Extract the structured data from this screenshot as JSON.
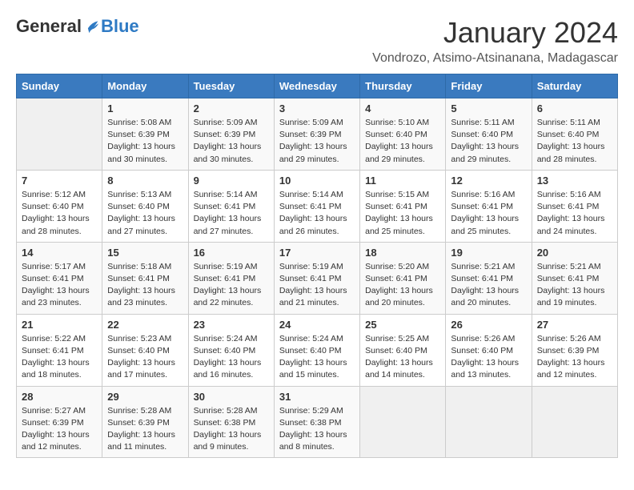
{
  "header": {
    "logo_general": "General",
    "logo_blue": "Blue",
    "month": "January 2024",
    "location": "Vondrozo, Atsimo-Atsinanana, Madagascar"
  },
  "days_of_week": [
    "Sunday",
    "Monday",
    "Tuesday",
    "Wednesday",
    "Thursday",
    "Friday",
    "Saturday"
  ],
  "weeks": [
    [
      {
        "day": "",
        "info": ""
      },
      {
        "day": "1",
        "info": "Sunrise: 5:08 AM\nSunset: 6:39 PM\nDaylight: 13 hours\nand 30 minutes."
      },
      {
        "day": "2",
        "info": "Sunrise: 5:09 AM\nSunset: 6:39 PM\nDaylight: 13 hours\nand 30 minutes."
      },
      {
        "day": "3",
        "info": "Sunrise: 5:09 AM\nSunset: 6:39 PM\nDaylight: 13 hours\nand 29 minutes."
      },
      {
        "day": "4",
        "info": "Sunrise: 5:10 AM\nSunset: 6:40 PM\nDaylight: 13 hours\nand 29 minutes."
      },
      {
        "day": "5",
        "info": "Sunrise: 5:11 AM\nSunset: 6:40 PM\nDaylight: 13 hours\nand 29 minutes."
      },
      {
        "day": "6",
        "info": "Sunrise: 5:11 AM\nSunset: 6:40 PM\nDaylight: 13 hours\nand 28 minutes."
      }
    ],
    [
      {
        "day": "7",
        "info": "Sunrise: 5:12 AM\nSunset: 6:40 PM\nDaylight: 13 hours\nand 28 minutes."
      },
      {
        "day": "8",
        "info": "Sunrise: 5:13 AM\nSunset: 6:40 PM\nDaylight: 13 hours\nand 27 minutes."
      },
      {
        "day": "9",
        "info": "Sunrise: 5:14 AM\nSunset: 6:41 PM\nDaylight: 13 hours\nand 27 minutes."
      },
      {
        "day": "10",
        "info": "Sunrise: 5:14 AM\nSunset: 6:41 PM\nDaylight: 13 hours\nand 26 minutes."
      },
      {
        "day": "11",
        "info": "Sunrise: 5:15 AM\nSunset: 6:41 PM\nDaylight: 13 hours\nand 25 minutes."
      },
      {
        "day": "12",
        "info": "Sunrise: 5:16 AM\nSunset: 6:41 PM\nDaylight: 13 hours\nand 25 minutes."
      },
      {
        "day": "13",
        "info": "Sunrise: 5:16 AM\nSunset: 6:41 PM\nDaylight: 13 hours\nand 24 minutes."
      }
    ],
    [
      {
        "day": "14",
        "info": "Sunrise: 5:17 AM\nSunset: 6:41 PM\nDaylight: 13 hours\nand 23 minutes."
      },
      {
        "day": "15",
        "info": "Sunrise: 5:18 AM\nSunset: 6:41 PM\nDaylight: 13 hours\nand 23 minutes."
      },
      {
        "day": "16",
        "info": "Sunrise: 5:19 AM\nSunset: 6:41 PM\nDaylight: 13 hours\nand 22 minutes."
      },
      {
        "day": "17",
        "info": "Sunrise: 5:19 AM\nSunset: 6:41 PM\nDaylight: 13 hours\nand 21 minutes."
      },
      {
        "day": "18",
        "info": "Sunrise: 5:20 AM\nSunset: 6:41 PM\nDaylight: 13 hours\nand 20 minutes."
      },
      {
        "day": "19",
        "info": "Sunrise: 5:21 AM\nSunset: 6:41 PM\nDaylight: 13 hours\nand 20 minutes."
      },
      {
        "day": "20",
        "info": "Sunrise: 5:21 AM\nSunset: 6:41 PM\nDaylight: 13 hours\nand 19 minutes."
      }
    ],
    [
      {
        "day": "21",
        "info": "Sunrise: 5:22 AM\nSunset: 6:41 PM\nDaylight: 13 hours\nand 18 minutes."
      },
      {
        "day": "22",
        "info": "Sunrise: 5:23 AM\nSunset: 6:40 PM\nDaylight: 13 hours\nand 17 minutes."
      },
      {
        "day": "23",
        "info": "Sunrise: 5:24 AM\nSunset: 6:40 PM\nDaylight: 13 hours\nand 16 minutes."
      },
      {
        "day": "24",
        "info": "Sunrise: 5:24 AM\nSunset: 6:40 PM\nDaylight: 13 hours\nand 15 minutes."
      },
      {
        "day": "25",
        "info": "Sunrise: 5:25 AM\nSunset: 6:40 PM\nDaylight: 13 hours\nand 14 minutes."
      },
      {
        "day": "26",
        "info": "Sunrise: 5:26 AM\nSunset: 6:40 PM\nDaylight: 13 hours\nand 13 minutes."
      },
      {
        "day": "27",
        "info": "Sunrise: 5:26 AM\nSunset: 6:39 PM\nDaylight: 13 hours\nand 12 minutes."
      }
    ],
    [
      {
        "day": "28",
        "info": "Sunrise: 5:27 AM\nSunset: 6:39 PM\nDaylight: 13 hours\nand 12 minutes."
      },
      {
        "day": "29",
        "info": "Sunrise: 5:28 AM\nSunset: 6:39 PM\nDaylight: 13 hours\nand 11 minutes."
      },
      {
        "day": "30",
        "info": "Sunrise: 5:28 AM\nSunset: 6:38 PM\nDaylight: 13 hours\nand 9 minutes."
      },
      {
        "day": "31",
        "info": "Sunrise: 5:29 AM\nSunset: 6:38 PM\nDaylight: 13 hours\nand 8 minutes."
      },
      {
        "day": "",
        "info": ""
      },
      {
        "day": "",
        "info": ""
      },
      {
        "day": "",
        "info": ""
      }
    ]
  ]
}
